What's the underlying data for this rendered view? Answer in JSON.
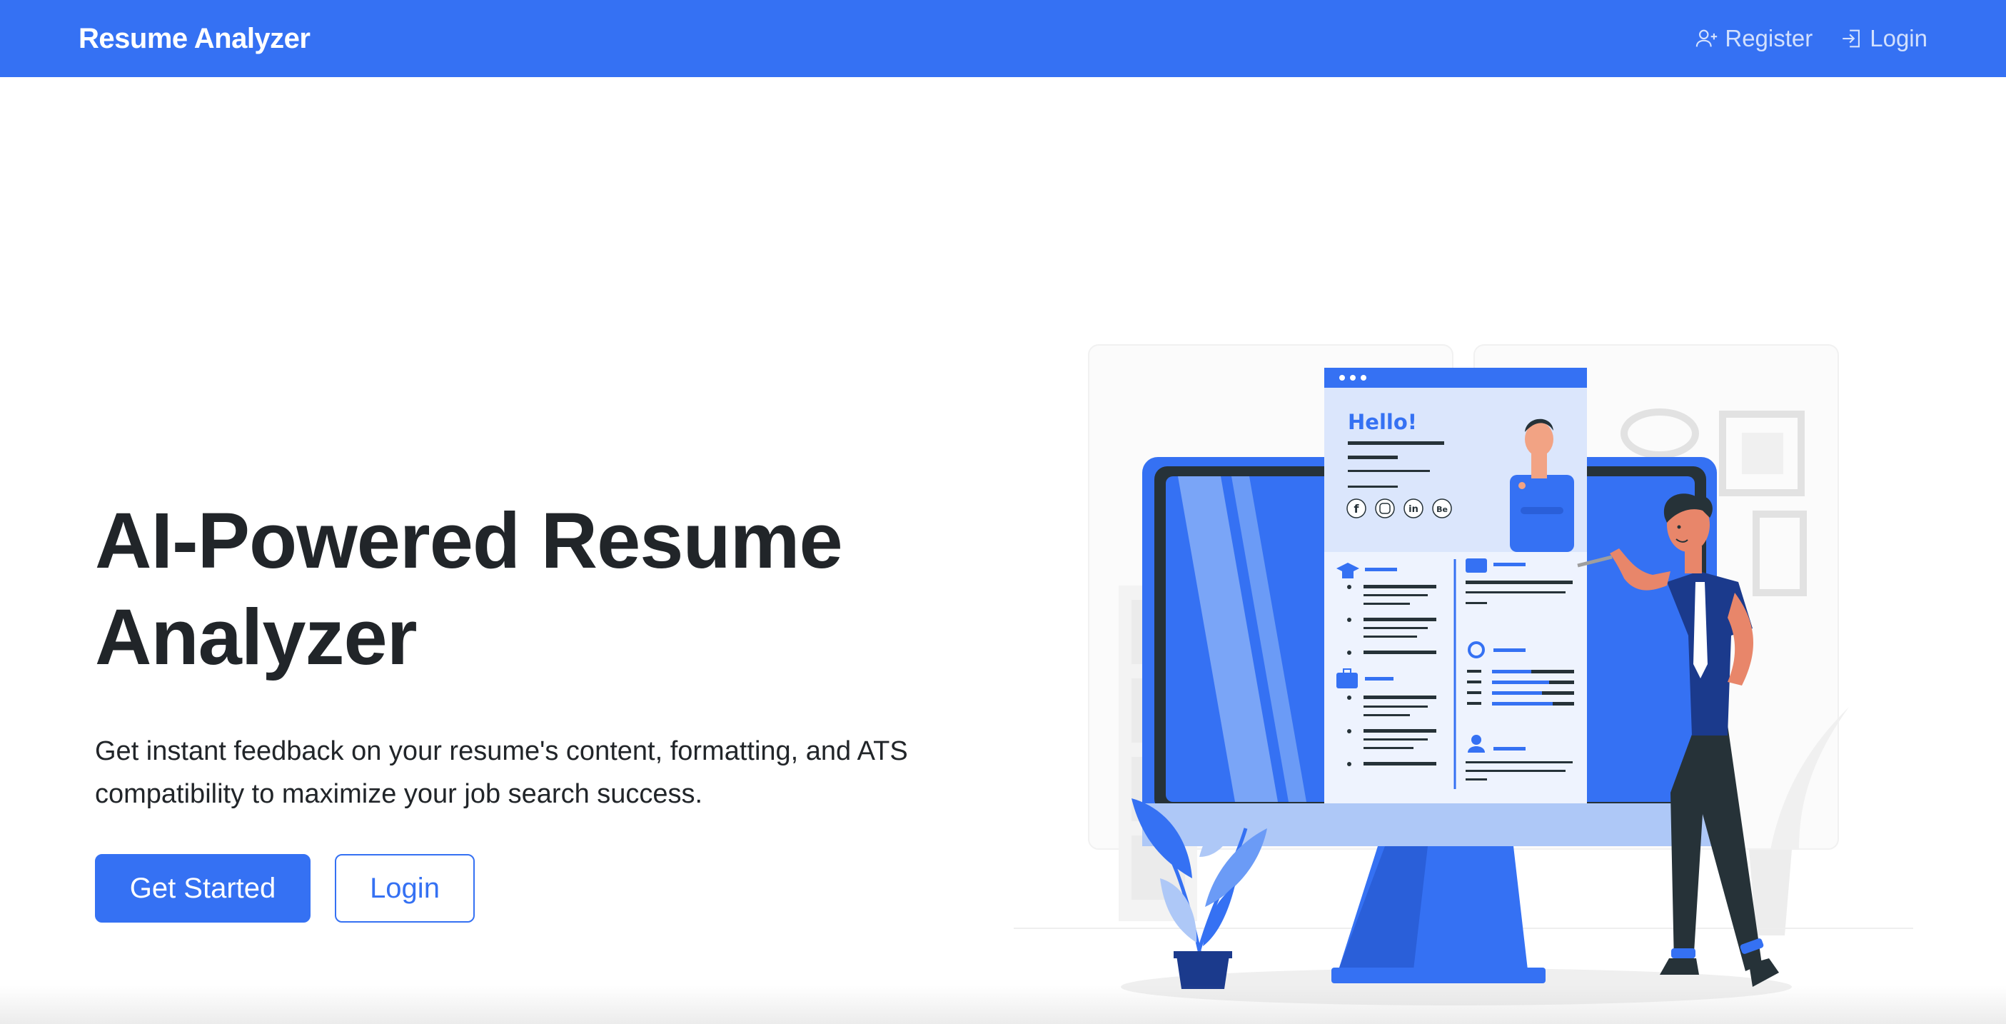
{
  "navbar": {
    "brand": "Resume Analyzer",
    "links": [
      {
        "label": "Register",
        "icon": "person-add-icon"
      },
      {
        "label": "Login",
        "icon": "login-icon"
      }
    ]
  },
  "hero": {
    "title_line1": "AI-Powered Resume",
    "title_line2": "Analyzer",
    "subtitle_line1": "Get instant feedback on your resume's content, formatting, and ATS",
    "subtitle_line2": "compatibility to maximize your job search success.",
    "primary_button": "Get Started",
    "secondary_button": "Login"
  },
  "illustration": {
    "greeting": "Hello!",
    "social_icons": [
      "f",
      "ig",
      "in",
      "Be"
    ]
  },
  "colors": {
    "primary": "#3571f3",
    "text": "#212529",
    "navy": "#1b3a8c",
    "light_blue": "#aec8f7"
  }
}
